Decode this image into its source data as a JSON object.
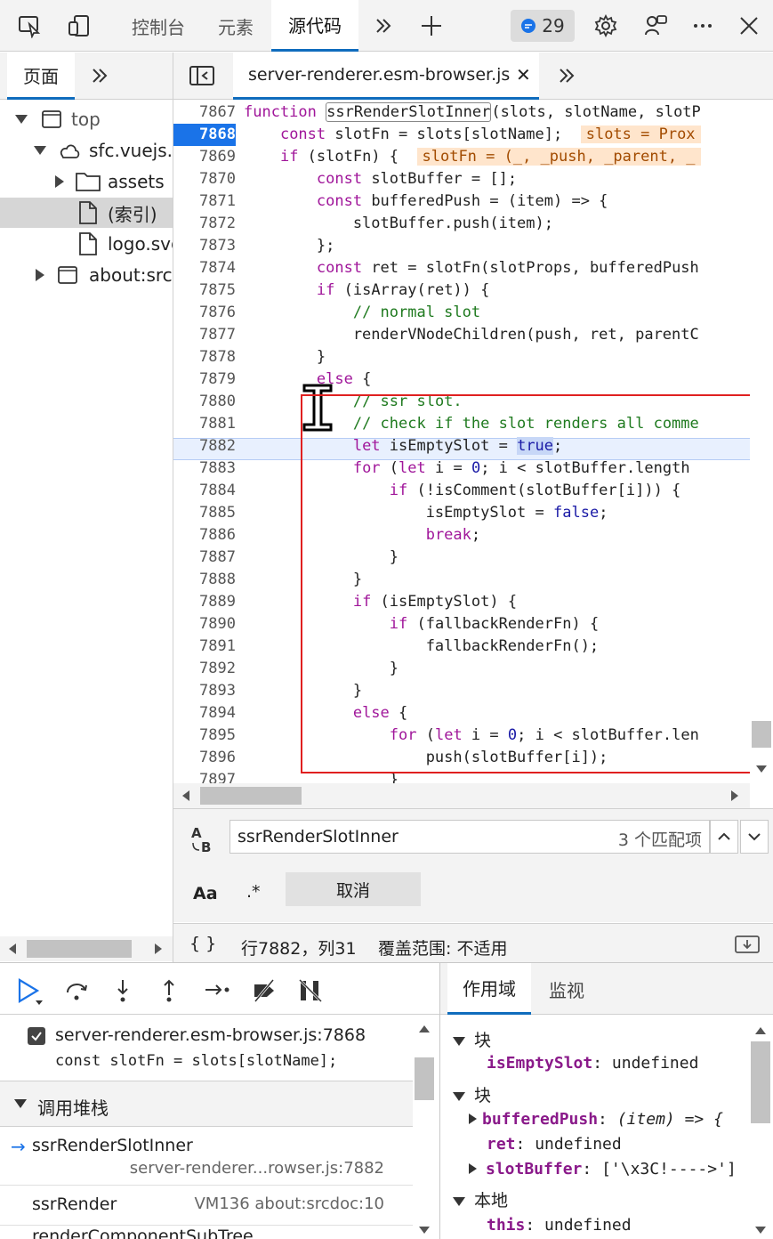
{
  "toolbar": {
    "tabs": [
      "控制台",
      "元素",
      "源代码"
    ],
    "issues_count": "29"
  },
  "navigator": {
    "tab_label": "页面",
    "tree": [
      {
        "label": "top"
      },
      {
        "label": "sfc.vuejs.o"
      },
      {
        "label": "assets"
      },
      {
        "label": "(索引)"
      },
      {
        "label": "logo.svg"
      },
      {
        "label": "about:srcdo"
      }
    ]
  },
  "editor": {
    "file_tab": "server-renderer.esm-browser.js",
    "current_line": "7868",
    "highlight_line": "7882",
    "lines": [
      {
        "n": "7867"
      },
      {
        "n": "7868"
      },
      {
        "n": "7869"
      },
      {
        "n": "7870"
      },
      {
        "n": "7871"
      },
      {
        "n": "7872"
      },
      {
        "n": "7873"
      },
      {
        "n": "7874"
      },
      {
        "n": "7875"
      },
      {
        "n": "7876"
      },
      {
        "n": "7877"
      },
      {
        "n": "7878"
      },
      {
        "n": "7879"
      },
      {
        "n": "7880"
      },
      {
        "n": "7881"
      },
      {
        "n": "7882"
      },
      {
        "n": "7883"
      },
      {
        "n": "7884"
      },
      {
        "n": "7885"
      },
      {
        "n": "7886"
      },
      {
        "n": "7887"
      },
      {
        "n": "7888"
      },
      {
        "n": "7889"
      },
      {
        "n": "7890"
      },
      {
        "n": "7891"
      },
      {
        "n": "7892"
      },
      {
        "n": "7893"
      },
      {
        "n": "7894"
      },
      {
        "n": "7895"
      },
      {
        "n": "7896"
      },
      {
        "n": "7897"
      }
    ]
  },
  "search": {
    "query": "ssrRenderSlotInner",
    "match_count": "3 个匹配项",
    "case_label": "Aa",
    "regex_label": ".*",
    "cancel_label": "取消"
  },
  "status": {
    "braces": "{ }",
    "position": "行7882，列31",
    "coverage": "覆盖范围: 不适用"
  },
  "debugger": {
    "breakpoint_file": "server-renderer.esm-browser.js:7868",
    "breakpoint_code": "const slotFn = slots[slotName];",
    "callstack_title": "调用堆栈",
    "frames": [
      {
        "name": "ssrRenderSlotInner",
        "location": "server-renderer...rowser.js:7882"
      },
      {
        "name": "ssrRender",
        "location": "VM136 about:srcdoc:10"
      },
      {
        "name": "renderComponentSubTree",
        "location": ""
      }
    ]
  },
  "scope": {
    "tabs": [
      "作用域",
      "监视"
    ],
    "sections": [
      {
        "title": "块",
        "items": [
          {
            "key": "isEmptySlot",
            "value": "undefined"
          }
        ]
      },
      {
        "title": "块",
        "items": [
          {
            "key": "bufferedPush",
            "value": "(item) => {"
          },
          {
            "key": "ret",
            "value": "undefined"
          },
          {
            "key": "slotBuffer",
            "value": "['\\x3C!---->']"
          }
        ]
      },
      {
        "title": "本地",
        "items": [
          {
            "key": "this",
            "value": "undefined"
          }
        ]
      }
    ]
  },
  "colors": {
    "accent": "#0f6cbd",
    "current_line": "#1a73e8",
    "annotation_box": "#e02020"
  }
}
